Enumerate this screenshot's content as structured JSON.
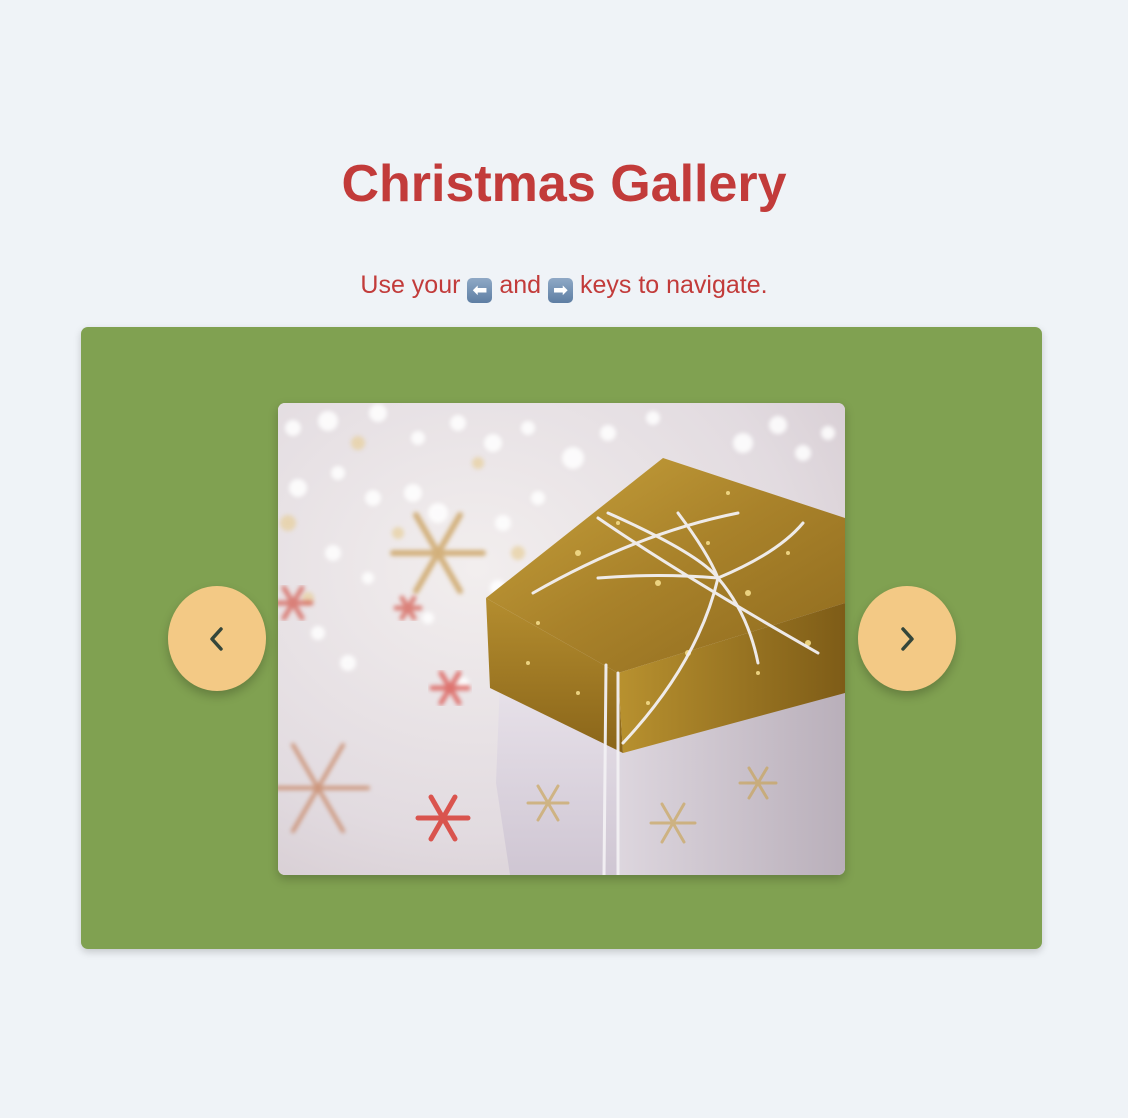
{
  "page": {
    "title": "Christmas Gallery",
    "instructions": {
      "before": "Use your",
      "middle": "and",
      "after": "keys to navigate.",
      "left_key_icon": "left-arrow-key-icon",
      "right_key_icon": "right-arrow-key-icon"
    }
  },
  "gallery": {
    "background_color": "#80a151",
    "image_description_icon": "gift-box-image",
    "prev_button_icon": "chevron-left-icon",
    "next_button_icon": "chevron-right-icon",
    "button_color": "#f3c985"
  },
  "colors": {
    "page_background": "#eff3f7",
    "heading": "#c23b3a"
  }
}
